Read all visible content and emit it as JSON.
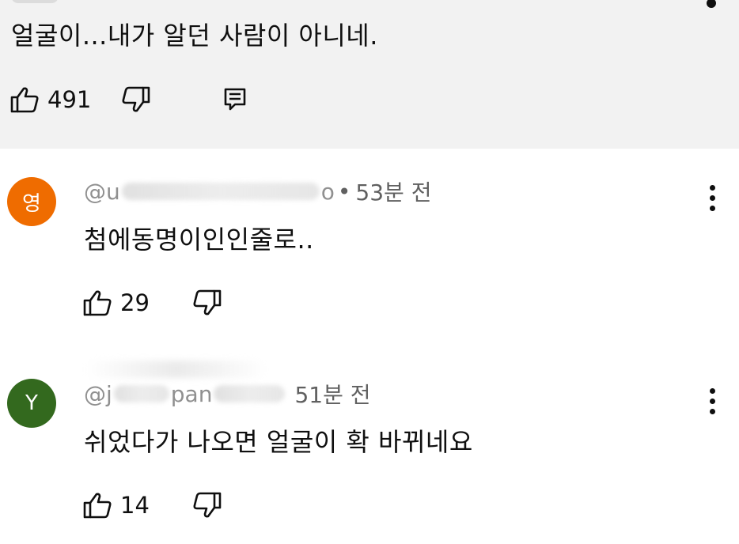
{
  "highlighted_comment": {
    "text": "얼굴이...내가 알던 사람이 아니네.",
    "likes": "491",
    "icons": [
      "thumb-up-icon",
      "thumb-down-icon",
      "reply-icon",
      "more-vert-icon"
    ]
  },
  "comments": [
    {
      "avatar_letter": "영",
      "avatar_color": "#ef6c00",
      "handle_prefix": "@u",
      "handle_suffix": "o",
      "time": "53분 전",
      "text": "첨에동명이인인줄로..",
      "likes": "29"
    },
    {
      "avatar_letter": "Y",
      "avatar_color": "#33691e",
      "handle_prefix": "@j",
      "handle_mid": "pan",
      "handle_suffix": "",
      "time": "51분 전",
      "text": "쉬었다가 나오면 얼굴이 확 바뀌네요",
      "likes": "14"
    }
  ],
  "colors": {
    "highlight_bg": "#f2f2f2",
    "secondary_text": "#606060",
    "primary_text": "#0f0f0f"
  }
}
